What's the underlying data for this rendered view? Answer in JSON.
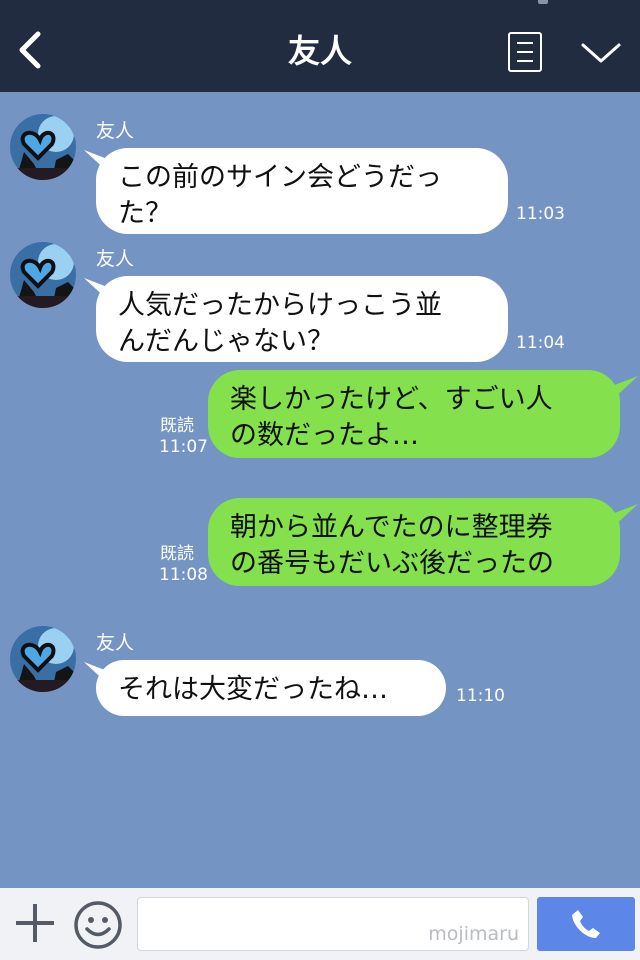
{
  "header": {
    "title": "友人",
    "back_icon": "chevron-left-icon",
    "menu_icon": "list-menu-icon",
    "expand_icon": "chevron-down-icon"
  },
  "messages": [
    {
      "side": "in",
      "sender": "友人",
      "text": "この前のサイン会どうだっ\nた？",
      "time": "11:03"
    },
    {
      "side": "in",
      "sender": "友人",
      "text": "人気だったからけっこう並\nんだんじゃない？",
      "time": "11:04"
    },
    {
      "side": "out",
      "read": "既読",
      "text": "楽しかったけど、すごい人\nの数だったよ…",
      "time": "11:07"
    },
    {
      "side": "out",
      "read": "既読",
      "text": "朝から並んでたのに整理券\nの番号もだいぶ後だったの",
      "time": "11:08"
    },
    {
      "side": "in",
      "sender": "友人",
      "text": "それは大変だったね…",
      "time": "11:10"
    }
  ],
  "footer": {
    "plus_icon": "plus-icon",
    "emoji_icon": "smiley-icon",
    "input_value": "",
    "watermark": "mojimaru",
    "call_icon": "phone-icon"
  },
  "colors": {
    "header_bg": "#222c40",
    "chat_bg": "#7494c3",
    "incoming_bubble": "#ffffff",
    "outgoing_bubble": "#84e14d",
    "call_button": "#5c87e8"
  }
}
